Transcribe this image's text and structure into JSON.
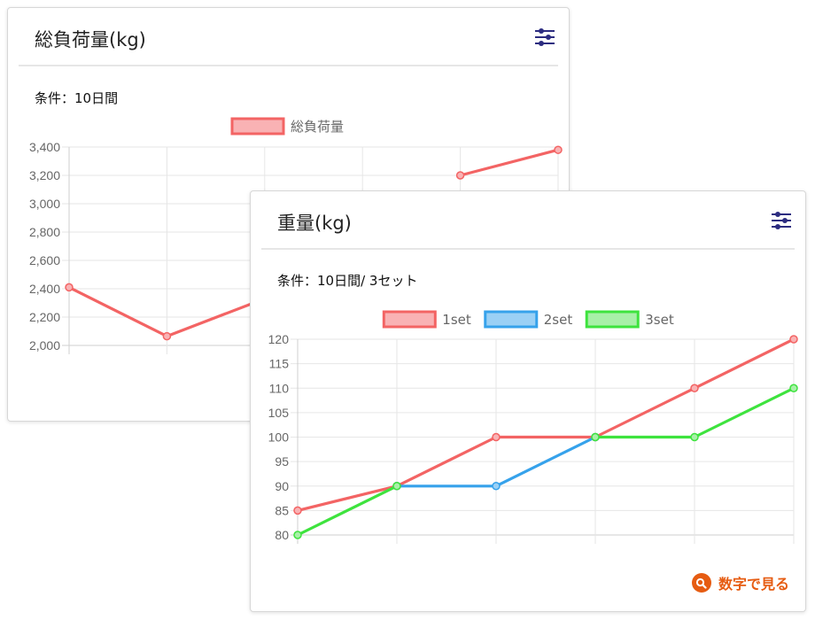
{
  "colors": {
    "red": "#f36464",
    "red_fill": "#f9b2b4",
    "blue": "#36a2eb",
    "blue_fill": "#9ad0f5",
    "green": "#3ee33e",
    "green_fill": "#a8f0a8",
    "link": "#e65c12",
    "icon": "#2c2c80"
  },
  "cards": [
    {
      "title": "総負荷量(kg)",
      "condition": "条件：10日間",
      "filter_icon": "sliders-icon"
    },
    {
      "title": "重量(kg)",
      "condition": "条件：10日間/ 3セット",
      "filter_icon": "sliders-icon",
      "view_numbers_label": "数字で見る",
      "view_numbers_icon": "search-icon"
    }
  ],
  "chart_data": [
    {
      "type": "line",
      "ylim": [
        2000,
        3400
      ],
      "yticks": [
        "2,000",
        "2,200",
        "2,400",
        "2,600",
        "2,800",
        "3,000",
        "3,200",
        "3,400"
      ],
      "ytick_values": [
        2000,
        2200,
        2400,
        2600,
        2800,
        3000,
        3200,
        3400
      ],
      "x": [
        0,
        1,
        2,
        3,
        4,
        5
      ],
      "grid": true,
      "legend_position": "top",
      "series": [
        {
          "name": "総負荷量",
          "values": [
            2410,
            2065,
            2330,
            null,
            3200,
            3380
          ],
          "color": "#f36464",
          "fill": "#f9b2b4"
        }
      ]
    },
    {
      "type": "line",
      "ylim": [
        80,
        120
      ],
      "yticks": [
        "80",
        "85",
        "90",
        "95",
        "100",
        "105",
        "110",
        "115",
        "120"
      ],
      "ytick_values": [
        80,
        85,
        90,
        95,
        100,
        105,
        110,
        115,
        120
      ],
      "x": [
        0,
        1,
        2,
        3,
        4,
        5
      ],
      "grid": true,
      "legend_position": "top",
      "series": [
        {
          "name": "1set",
          "values": [
            85,
            90,
            100,
            100,
            110,
            120
          ],
          "color": "#f36464",
          "fill": "#f9b2b4"
        },
        {
          "name": "2set",
          "values": [
            null,
            90,
            90,
            100,
            null,
            null
          ],
          "color": "#36a2eb",
          "fill": "#9ad0f5"
        },
        {
          "name": "3set",
          "values": [
            80,
            90,
            null,
            100,
            100,
            110
          ],
          "color": "#3ee33e",
          "fill": "#a8f0a8"
        }
      ]
    }
  ]
}
